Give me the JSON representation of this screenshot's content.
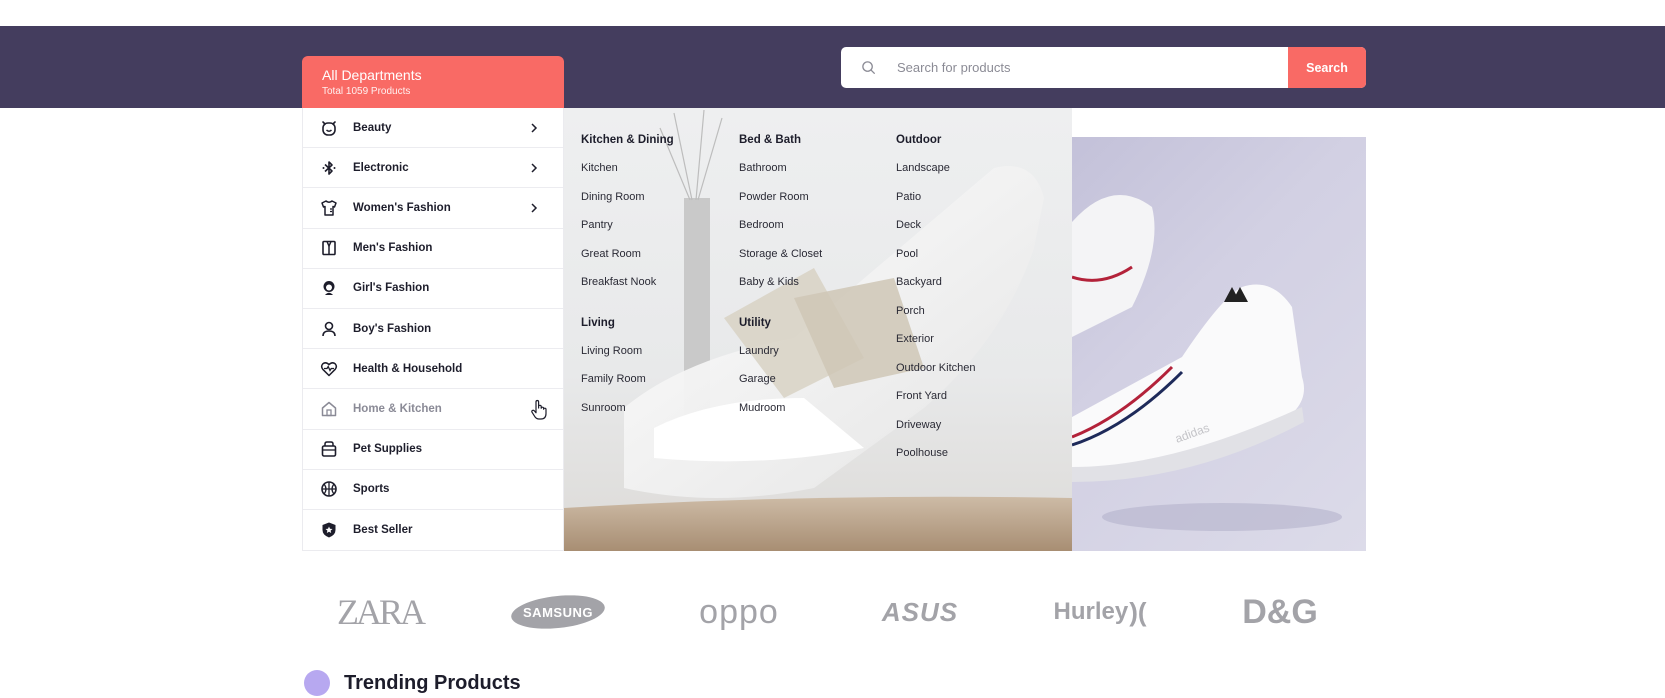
{
  "header": {
    "departments_title": "All Departments",
    "departments_subtitle": "Total 1059 Products",
    "search": {
      "placeholder": "Search for products",
      "button_label": "Search"
    }
  },
  "colors": {
    "accent": "#f96a65",
    "band": "#443d5e",
    "trending_dot": "#b7a8f0"
  },
  "sidebar": {
    "items": [
      {
        "label": "Beauty",
        "icon": "bear-face-icon",
        "has_submenu": true
      },
      {
        "label": "Electronic",
        "icon": "bluetooth-icon",
        "has_submenu": true
      },
      {
        "label": "Women's Fashion",
        "icon": "dress-icon",
        "has_submenu": true
      },
      {
        "label": "Men's Fashion",
        "icon": "suit-icon",
        "has_submenu": false
      },
      {
        "label": "Girl's Fashion",
        "icon": "girl-icon",
        "has_submenu": false
      },
      {
        "label": "Boy's Fashion",
        "icon": "person-icon",
        "has_submenu": false
      },
      {
        "label": "Health & Household",
        "icon": "heart-pulse-icon",
        "has_submenu": false
      },
      {
        "label": "Home & Kitchen",
        "icon": "home-icon",
        "has_submenu": false,
        "hovered": true
      },
      {
        "label": "Pet Supplies",
        "icon": "pet-carrier-icon",
        "has_submenu": false
      },
      {
        "label": "Sports",
        "icon": "basketball-icon",
        "has_submenu": false
      },
      {
        "label": "Best Seller",
        "icon": "badge-icon",
        "has_submenu": false
      }
    ]
  },
  "mega_menu": {
    "columns": [
      {
        "groups": [
          {
            "heading": "Kitchen & Dining",
            "links": [
              "Kitchen",
              "Dining Room",
              "Pantry",
              "Great Room",
              "Breakfast Nook"
            ]
          },
          {
            "heading": "Living",
            "links": [
              "Living Room",
              "Family Room",
              "Sunroom"
            ]
          }
        ]
      },
      {
        "groups": [
          {
            "heading": "Bed & Bath",
            "links": [
              "Bathroom",
              "Powder Room",
              "Bedroom",
              "Storage & Closet",
              "Baby & Kids"
            ]
          },
          {
            "heading": "Utility",
            "links": [
              "Laundry",
              "Garage",
              "Mudroom"
            ]
          }
        ]
      },
      {
        "groups": [
          {
            "heading": "Outdoor",
            "links": [
              "Landscape",
              "Patio",
              "Deck",
              "Pool",
              "Backyard",
              "Porch",
              "Exterior",
              "Outdoor Kitchen",
              "Front Yard",
              "Driveway",
              "Poolhouse"
            ]
          }
        ]
      }
    ]
  },
  "brands": [
    "ZARA",
    "SAMSUNG",
    "oppo",
    "ASUS",
    "Hurley",
    "D&G"
  ],
  "trending": {
    "title": "Trending Products"
  }
}
